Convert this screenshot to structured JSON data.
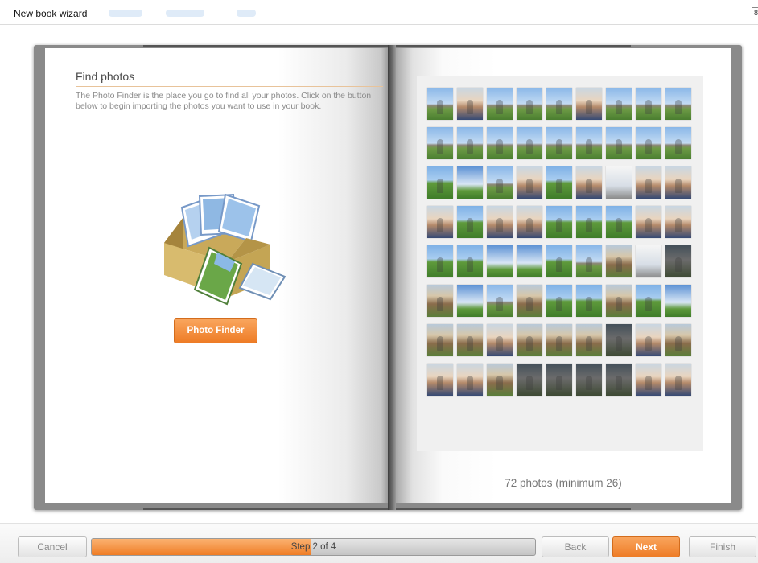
{
  "window": {
    "title": "New book wizard"
  },
  "left_page": {
    "heading": "Find photos",
    "description": "The Photo Finder is the place you go to find all your photos. Click on the button below to begin importing the photos you want to use in your book.",
    "illustration_icon": "photo-box-icon",
    "photo_finder_label": "Photo Finder"
  },
  "right_page": {
    "photo_count_text": "72 photos (minimum 26)",
    "photos": [
      "stones",
      "portrait",
      "stones",
      "stones",
      "stones",
      "portrait",
      "stones",
      "stones",
      "stones",
      "stones",
      "stones",
      "stones",
      "stones",
      "stones",
      "stones",
      "stones",
      "stones",
      "stones",
      "outdoor",
      "sky",
      "stones",
      "portrait",
      "outdoor",
      "portrait",
      "light",
      "portrait",
      "portrait",
      "portrait",
      "outdoor",
      "portrait",
      "portrait",
      "outdoor",
      "outdoor",
      "outdoor",
      "portrait",
      "portrait",
      "outdoor",
      "outdoor",
      "sky",
      "sky",
      "outdoor",
      "stones",
      "village",
      "light",
      "dark",
      "village",
      "sky",
      "stones",
      "village",
      "outdoor",
      "outdoor",
      "village",
      "outdoor",
      "sky",
      "village",
      "village",
      "portrait",
      "village",
      "village",
      "village",
      "dark",
      "portrait",
      "village",
      "portrait",
      "portrait",
      "village",
      "dark",
      "dark",
      "dark",
      "dark",
      "portrait",
      "portrait"
    ]
  },
  "footer": {
    "cancel_label": "Cancel",
    "progress_text": "Step 2 of 4",
    "progress_fraction": 0.495,
    "back_label": "Back",
    "next_label": "Next",
    "finish_label": "Finish"
  },
  "colors": {
    "accent": "#f08a35",
    "accent_border": "#d36c1c"
  }
}
